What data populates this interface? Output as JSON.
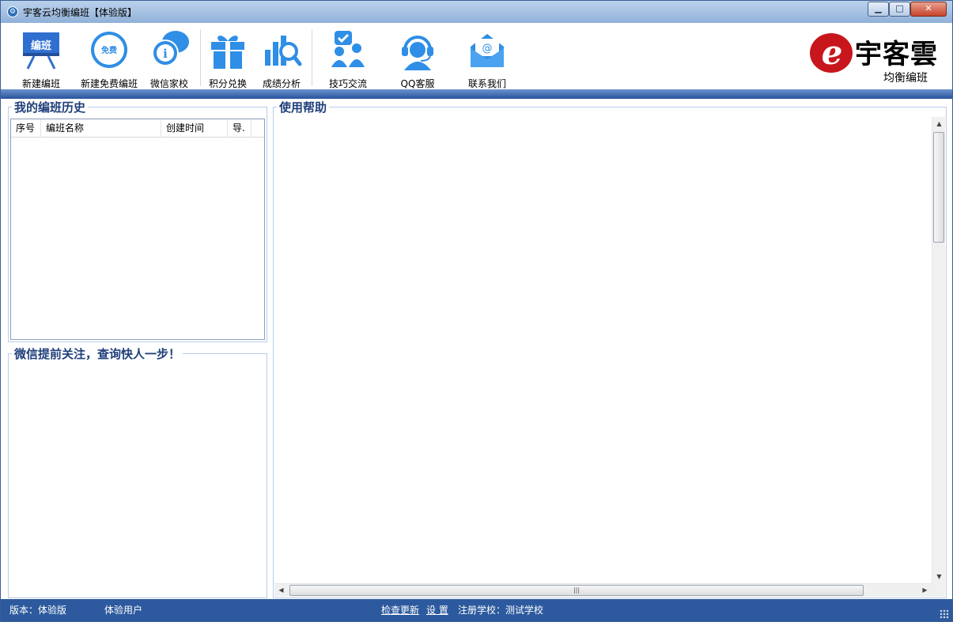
{
  "window": {
    "title": "宇客云均衡编班【体验版】",
    "controls": {
      "minimize": "▁",
      "maximize": "□",
      "close": "✕"
    }
  },
  "toolbar": {
    "items": [
      {
        "label": "新建编班",
        "icon": "blackboard-icon",
        "icon_text": "编班"
      },
      {
        "label": "新建免费编班",
        "icon": "free-badge-icon",
        "icon_text": "免费"
      },
      {
        "label": "微信家校",
        "icon": "info-chat-icon"
      },
      {
        "label": "积分兑换",
        "icon": "gift-icon"
      },
      {
        "label": "成绩分析",
        "icon": "chart-search-icon"
      },
      {
        "label": "技巧交流",
        "icon": "people-chat-icon"
      },
      {
        "label": "QQ客服",
        "icon": "headset-icon"
      },
      {
        "label": "联系我们",
        "icon": "mail-icon"
      }
    ]
  },
  "logo": {
    "brand": "宇客雲",
    "subtitle": "均衡编班",
    "mark": "e"
  },
  "history": {
    "title": "我的编班历史",
    "columns": [
      "序号",
      "编班名称",
      "创建时间",
      "导."
    ],
    "rows": []
  },
  "wechat": {
    "title": "微信提前关注，查询快人一步！"
  },
  "help": {
    "title": "使用帮助"
  },
  "status": {
    "version": "版本：体验版",
    "user": "体验用户",
    "check_update": "检查更新",
    "settings": "设 置",
    "school": "注册学校：测试学校"
  },
  "colors": {
    "accent": "#2d5a9e",
    "icon_blue": "#2f8ee5",
    "group_title": "#1f3f7a"
  }
}
